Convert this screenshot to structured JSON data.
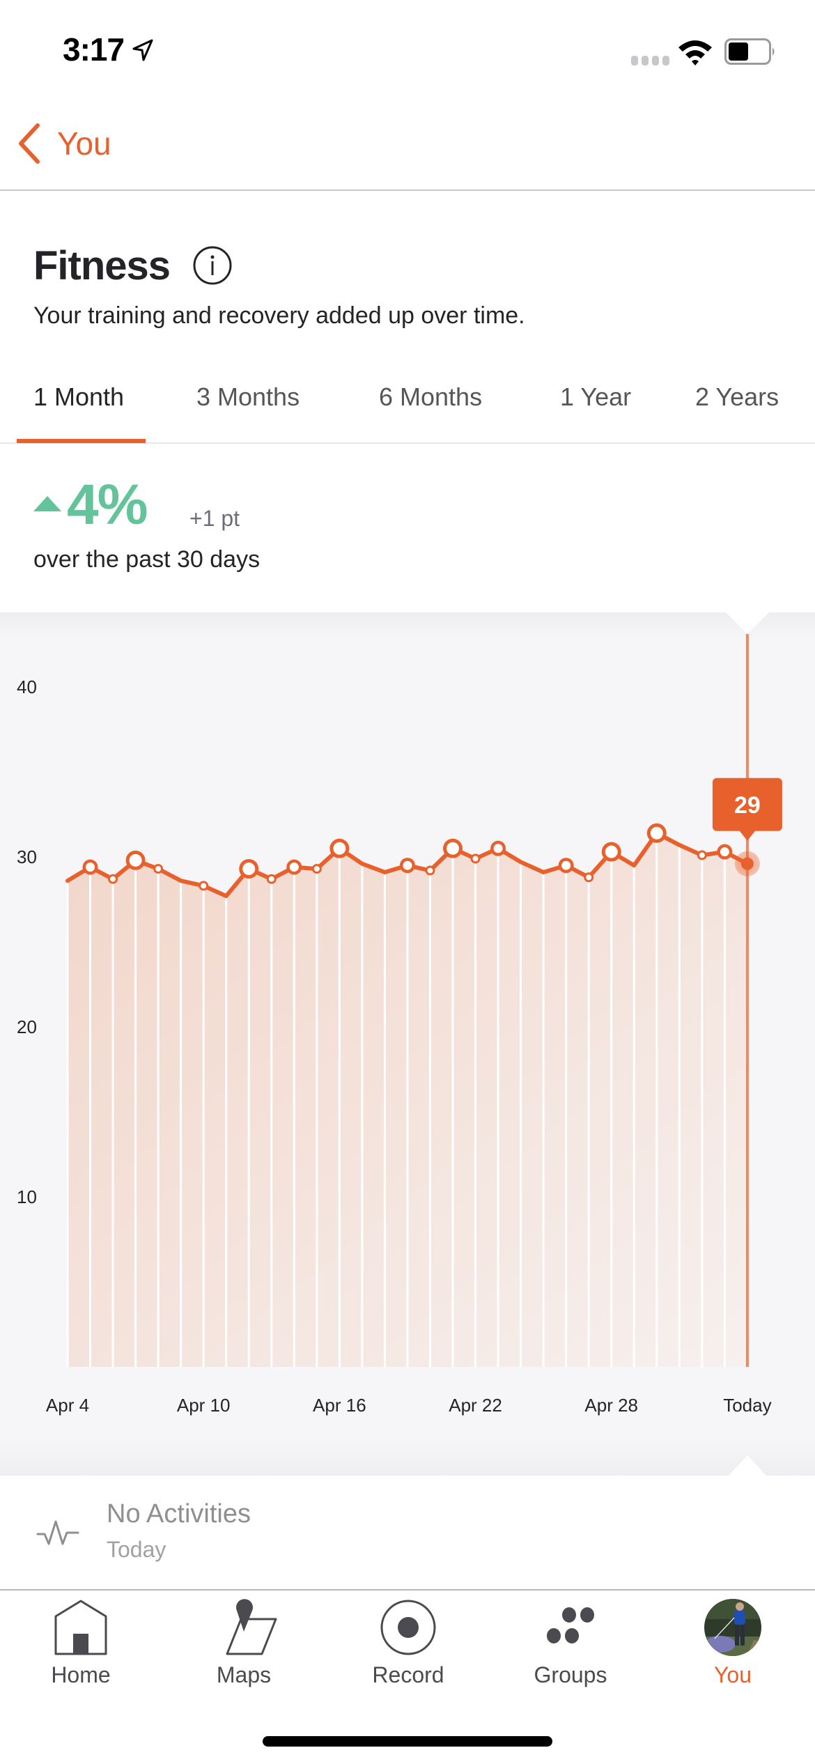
{
  "status_bar": {
    "time": "3:17",
    "battery_level": 0.5,
    "icons": [
      "location-arrow-icon",
      "signal-icon",
      "wifi-icon",
      "battery-icon"
    ]
  },
  "nav": {
    "back_label": "You",
    "back_icon": "chevron-left-icon"
  },
  "header": {
    "title": "Fitness",
    "info_icon": "info-icon",
    "subtitle": "Your training and recovery added up over time."
  },
  "range_tabs": [
    {
      "label": "1 Month",
      "active": true
    },
    {
      "label": "3 Months",
      "active": false
    },
    {
      "label": "6 Months",
      "active": false
    },
    {
      "label": "1 Year",
      "active": false
    },
    {
      "label": "2 Years",
      "active": false
    }
  ],
  "summary": {
    "trend_direction": "up",
    "change_percent": "4%",
    "change_points": "+1 pt",
    "period": "over the past 30 days"
  },
  "colors": {
    "accent": "#e8612c",
    "trend_up": "#63c39a",
    "fill_top": "#f2d6ca",
    "fill_bottom": "#f6f0ee",
    "chart_bg": "#f6f6f8"
  },
  "chart_data": {
    "type": "area",
    "title": "Fitness",
    "xlabel": "",
    "ylabel": "",
    "ylim": [
      0,
      40
    ],
    "yticks": [
      10,
      20,
      30,
      40
    ],
    "x_tick_labels": [
      {
        "index": 0,
        "label": "Apr 4"
      },
      {
        "index": 6,
        "label": "Apr 10"
      },
      {
        "index": 12,
        "label": "Apr 16"
      },
      {
        "index": 18,
        "label": "Apr 22"
      },
      {
        "index": 24,
        "label": "Apr 28"
      },
      {
        "index": 30,
        "label": "Today"
      }
    ],
    "x": [
      "Apr 4",
      "Apr 5",
      "Apr 6",
      "Apr 7",
      "Apr 8",
      "Apr 9",
      "Apr 10",
      "Apr 11",
      "Apr 12",
      "Apr 13",
      "Apr 14",
      "Apr 15",
      "Apr 16",
      "Apr 17",
      "Apr 18",
      "Apr 19",
      "Apr 20",
      "Apr 21",
      "Apr 22",
      "Apr 23",
      "Apr 24",
      "Apr 25",
      "Apr 26",
      "Apr 27",
      "Apr 28",
      "Apr 29",
      "Apr 30",
      "May 1",
      "May 2",
      "May 3",
      "Today"
    ],
    "series": [
      {
        "name": "Fitness",
        "values": [
          28.6,
          29.4,
          28.7,
          29.8,
          29.3,
          28.6,
          28.3,
          27.7,
          29.3,
          28.7,
          29.4,
          29.3,
          30.5,
          29.6,
          29.1,
          29.5,
          29.2,
          30.5,
          29.9,
          30.5,
          29.7,
          29.1,
          29.5,
          28.8,
          30.3,
          29.5,
          31.4,
          30.7,
          30.1,
          30.3,
          29.6
        ],
        "activity_markers": [
          "none",
          "medium",
          "small",
          "large",
          "small",
          "none",
          "small",
          "none",
          "large",
          "small",
          "medium",
          "small",
          "large",
          "none",
          "none",
          "medium",
          "small",
          "large",
          "small",
          "medium",
          "none",
          "none",
          "medium",
          "small",
          "large",
          "none",
          "large",
          "none",
          "small",
          "medium",
          "selected"
        ]
      }
    ],
    "selected": {
      "index": 30,
      "label": "29"
    },
    "grid": false,
    "legend": "none"
  },
  "activity": {
    "icon": "activity-pulse-icon",
    "title": "No Activities",
    "subtitle": "Today"
  },
  "tab_bar": [
    {
      "label": "Home",
      "icon": "home-icon",
      "active": false
    },
    {
      "label": "Maps",
      "icon": "map-pin-icon",
      "active": false
    },
    {
      "label": "Record",
      "icon": "record-icon",
      "active": false
    },
    {
      "label": "Groups",
      "icon": "groups-icon",
      "active": false
    },
    {
      "label": "You",
      "icon": "avatar",
      "active": true
    }
  ]
}
